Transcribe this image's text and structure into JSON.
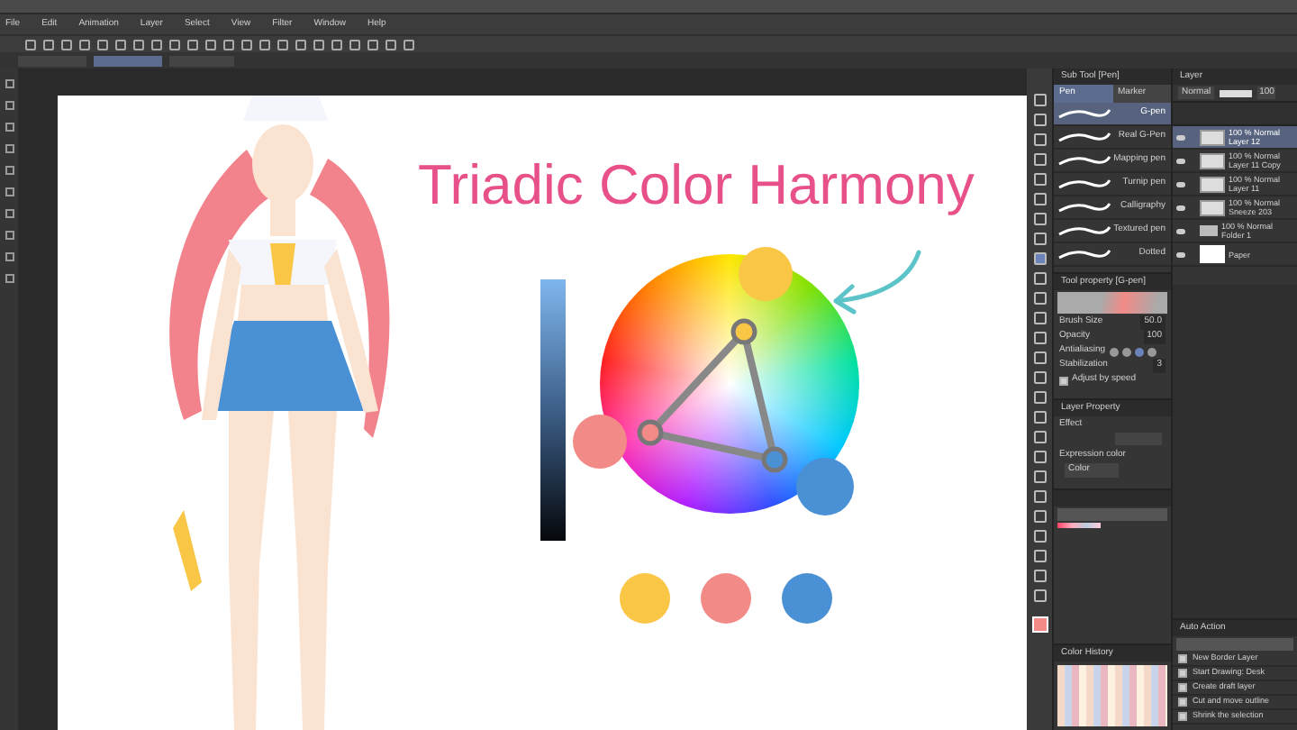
{
  "menu": [
    "File",
    "Edit",
    "Animation",
    "Layer",
    "Select",
    "View",
    "Filter",
    "Window",
    "Help"
  ],
  "canvas": {
    "title": "Triadic Color Harmony",
    "picks": [
      {
        "color": "#f9c646"
      },
      {
        "color": "#f28b87"
      },
      {
        "color": "#4a90d4"
      }
    ],
    "swatches": [
      {
        "color": "#f9c646"
      },
      {
        "color": "#f28b87"
      },
      {
        "color": "#4a90d4"
      }
    ]
  },
  "sub_tool": {
    "title": "Sub Tool [Pen]",
    "tabs": [
      {
        "label": "Pen",
        "selected": true
      },
      {
        "label": "Marker",
        "selected": false
      }
    ],
    "items": [
      {
        "label": "G-pen",
        "selected": true
      },
      {
        "label": "Real G-Pen",
        "selected": false
      },
      {
        "label": "Mapping pen",
        "selected": false
      },
      {
        "label": "Turnip pen",
        "selected": false
      },
      {
        "label": "Calligraphy",
        "selected": false
      },
      {
        "label": "Textured pen",
        "selected": false
      },
      {
        "label": "Dotted",
        "selected": false
      }
    ]
  },
  "tool_property": {
    "title": "Tool property [G-pen]",
    "rows": [
      {
        "kind": "number",
        "label": "Brush Size",
        "value": "50.0"
      },
      {
        "kind": "number",
        "label": "Opacity",
        "value": "100"
      },
      {
        "kind": "toggle",
        "label": "Antialiasing"
      },
      {
        "kind": "number",
        "label": "Stabilization",
        "value": "3"
      },
      {
        "kind": "check",
        "label": "Adjust by speed",
        "checked": true
      }
    ]
  },
  "layer_property": {
    "title": "Layer Property",
    "effect": "Effect",
    "expression_label": "Expression color",
    "expression_value": "Color"
  },
  "layers": {
    "title": "Layer",
    "blend": "Normal",
    "opacity": "100",
    "opacity_slider": {
      "level": 1.0
    },
    "items": [
      {
        "kind": "layer",
        "mode": "100 % Normal",
        "name": "Layer 12",
        "selected": true
      },
      {
        "kind": "layer",
        "mode": "100 % Normal",
        "name": "Layer 11 Copy",
        "selected": false
      },
      {
        "kind": "layer",
        "mode": "100 % Normal",
        "name": "Layer 11",
        "selected": false
      },
      {
        "kind": "layer",
        "mode": "100 % Normal",
        "name": "Sneeze 203",
        "selected": false
      },
      {
        "kind": "folder",
        "mode": "100 % Normal",
        "name": "Folder 1",
        "selected": false
      },
      {
        "kind": "paper",
        "name": "Paper",
        "selected": false
      }
    ]
  },
  "auto_action": {
    "title": "Auto Action",
    "items": [
      {
        "label": "New Border Layer",
        "checked": true
      },
      {
        "label": "Start Drawing: Desk",
        "checked": true
      },
      {
        "label": "Create draft layer",
        "checked": true
      },
      {
        "label": "Cut and move outline",
        "checked": true
      },
      {
        "label": "Shrink the selection",
        "checked": true
      }
    ]
  },
  "color_history": {
    "title": "Color History"
  }
}
